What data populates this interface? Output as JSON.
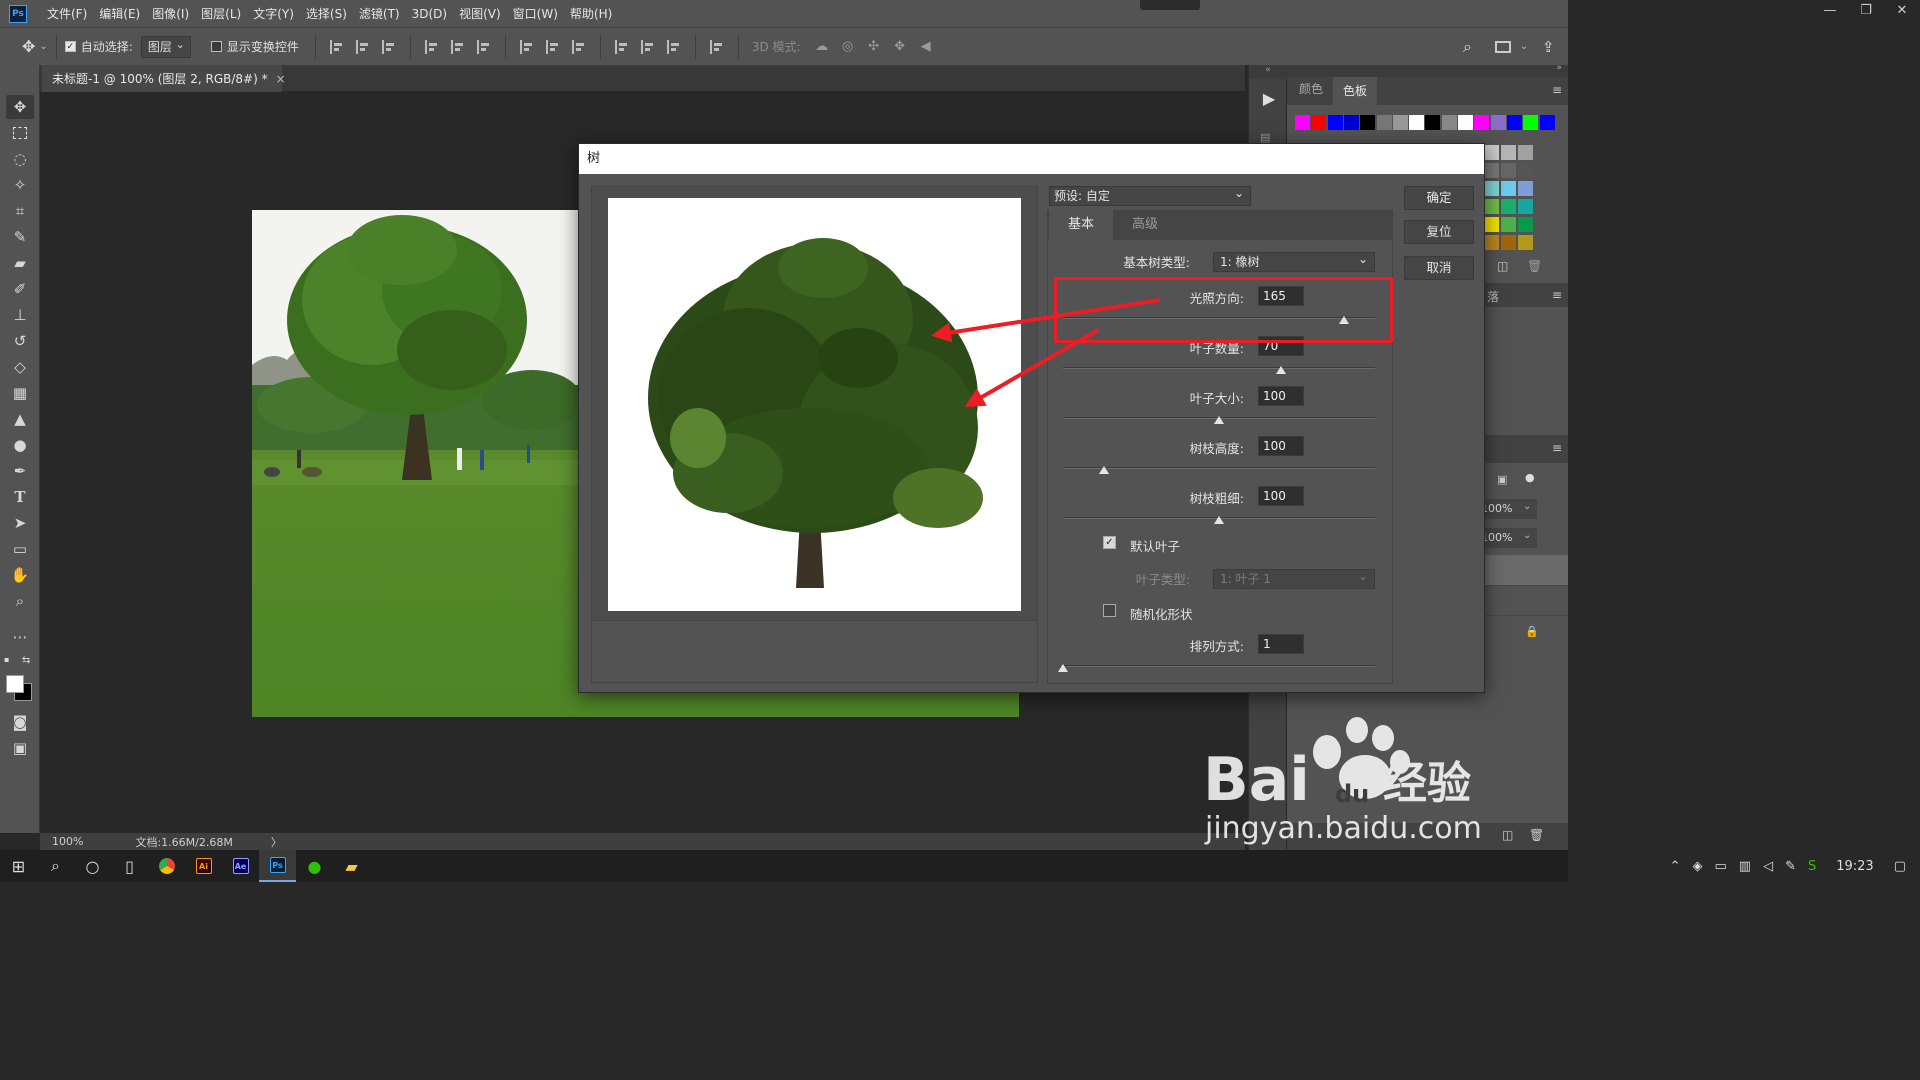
{
  "app": {
    "logo": "Ps"
  },
  "menu": [
    "文件(F)",
    "编辑(E)",
    "图像(I)",
    "图层(L)",
    "文字(Y)",
    "选择(S)",
    "滤镜(T)",
    "3D(D)",
    "视图(V)",
    "窗口(W)",
    "帮助(H)"
  ],
  "window_controls": [
    "—",
    "❐",
    "✕"
  ],
  "options": {
    "auto_select_label": "自动选择:",
    "auto_select_target": "图层",
    "show_transform_label": "显示变换控件",
    "mode3d_label": "3D 模式:"
  },
  "document": {
    "tab_title": "未标题-1 @ 100% (图层 2, RGB/8#) *",
    "close": "×"
  },
  "status": {
    "zoom": "100%",
    "doc_info": "文档:1.66M/2.68M",
    "arrow": "〉"
  },
  "right_panel": {
    "tabs": [
      "颜色",
      "色板"
    ],
    "active_tab": "色板",
    "partial_label": "落",
    "opacity_1": "100%",
    "opacity_2": "100%"
  },
  "swatches_row": [
    "#ff00ff",
    "#ff0000",
    "#0000ff",
    "#0000cc",
    "#000000",
    "#777777",
    "#999999",
    "#ffffff",
    "#000000",
    "#888888",
    "#ffffff",
    "#ff00ff",
    "#8a6cc9",
    "#0000ff",
    "#00ff00",
    "#0000ff"
  ],
  "dialog": {
    "title": "树",
    "preset_label": "预设: 自定",
    "tabs": [
      "基本",
      "高级"
    ],
    "active_tab": "基本",
    "buttons": {
      "ok": "确定",
      "reset": "复位",
      "cancel": "取消"
    },
    "base_tree_label": "基本树类型:",
    "base_tree_value": "1: 橡树",
    "params": [
      {
        "label": "光照方向:",
        "value": "165",
        "slider": 0.9
      },
      {
        "label": "叶子数量:",
        "value": "70",
        "slider": 0.7
      },
      {
        "label": "叶子大小:",
        "value": "100",
        "slider": 0.5
      },
      {
        "label": "树枝高度:",
        "value": "100",
        "slider": 0.13
      },
      {
        "label": "树枝粗细:",
        "value": "100",
        "slider": 0.5
      }
    ],
    "default_leaves_label": "默认叶子",
    "leaf_type_label": "叶子类型:",
    "leaf_type_value": "1: 叶子 1",
    "randomize_label": "随机化形状",
    "arrangement_label": "排列方式:",
    "arrangement_value": "1",
    "arrangement_slider": 0.0
  },
  "taskbar": {
    "apps": [
      "Ai",
      "Ae",
      "Ps"
    ],
    "time": "19:23"
  },
  "watermark": {
    "brand": "Bai",
    "brand2": "du",
    "cn": "经验",
    "url": "jingyan.baidu.com"
  },
  "colors": {
    "highlight": "#ee1c24",
    "ps_blue": "#31a8ff"
  }
}
